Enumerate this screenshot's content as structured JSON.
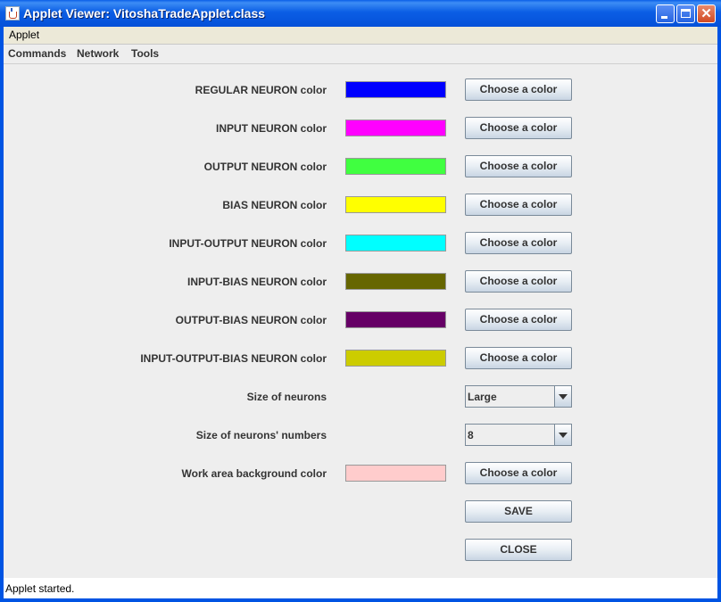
{
  "window": {
    "title": "Applet Viewer: VitoshaTradeApplet.class"
  },
  "applet_menu": {
    "label": "Applet"
  },
  "menubar": {
    "items": [
      "Commands",
      "Network",
      "Tools"
    ]
  },
  "settings": [
    {
      "label": "REGULAR NEURON color",
      "color": "#0000FF",
      "button": "Choose a color"
    },
    {
      "label": "INPUT NEURON color",
      "color": "#FF00FF",
      "button": "Choose a color"
    },
    {
      "label": "OUTPUT NEURON color",
      "color": "#40FF40",
      "button": "Choose a color"
    },
    {
      "label": "BIAS NEURON color",
      "color": "#FFFF00",
      "button": "Choose a color"
    },
    {
      "label": "INPUT-OUTPUT NEURON color",
      "color": "#00FFFF",
      "button": "Choose a color"
    },
    {
      "label": "INPUT-BIAS NEURON color",
      "color": "#666600",
      "button": "Choose a color"
    },
    {
      "label": "OUTPUT-BIAS NEURON color",
      "color": "#660066",
      "button": "Choose a color"
    },
    {
      "label": "INPUT-OUTPUT-BIAS NEURON color",
      "color": "#CCCC00",
      "button": "Choose a color"
    }
  ],
  "size_of_neurons": {
    "label": "Size of neurons",
    "value": "Large"
  },
  "size_of_numbers": {
    "label": "Size of neurons' numbers",
    "value": "8"
  },
  "work_area": {
    "label": "Work area background color",
    "color": "#FFCCCC",
    "button": "Choose a color"
  },
  "actions": {
    "save": "SAVE",
    "close": "CLOSE"
  },
  "status": {
    "text": "Applet started."
  }
}
